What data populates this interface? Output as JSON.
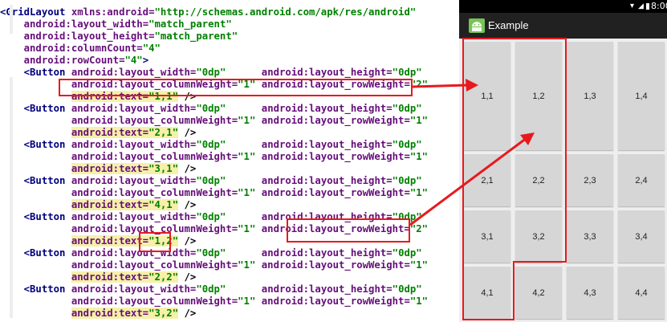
{
  "code_lines": [
    [
      {
        "c": "tag",
        "t": "<GridLayout "
      },
      {
        "c": "attr",
        "t": "xmlns:android="
      },
      {
        "c": "val",
        "t": "\"http://schemas.android.com/apk/res/android\""
      }
    ],
    [
      {
        "c": "pad",
        "t": "    "
      },
      {
        "c": "attr",
        "t": "android:layout_width="
      },
      {
        "c": "val",
        "t": "\"match_parent\""
      }
    ],
    [
      {
        "c": "pad",
        "t": "    "
      },
      {
        "c": "attr",
        "t": "android:layout_height="
      },
      {
        "c": "val",
        "t": "\"match_parent\""
      }
    ],
    [
      {
        "c": "pad",
        "t": "    "
      },
      {
        "c": "attr",
        "t": "android:columnCount="
      },
      {
        "c": "val",
        "t": "\"4\""
      }
    ],
    [
      {
        "c": "pad",
        "t": "    "
      },
      {
        "c": "attr",
        "t": "android:rowCount="
      },
      {
        "c": "val",
        "t": "\"4\""
      },
      {
        "c": "tag",
        "t": ">"
      }
    ],
    [
      {
        "c": "pad",
        "t": "    "
      },
      {
        "c": "tag",
        "t": "<Button "
      },
      {
        "c": "attr",
        "t": "android:layout_width="
      },
      {
        "c": "val",
        "t": "\"0dp\""
      },
      {
        "c": "pad",
        "t": "      "
      },
      {
        "c": "attr",
        "t": "android:layout_height="
      },
      {
        "c": "val",
        "t": "\"0dp\""
      }
    ],
    [
      {
        "c": "pad",
        "t": "            "
      },
      {
        "c": "attr",
        "t": "android:layout_columnWeight="
      },
      {
        "c": "val",
        "t": "\"1\""
      },
      {
        "c": "pad",
        "t": " "
      },
      {
        "c": "attr",
        "t": "android:layout_rowWeight="
      },
      {
        "c": "val",
        "t": "\"2\""
      }
    ],
    [
      {
        "c": "pad",
        "t": "            "
      },
      {
        "c": "attr hl",
        "t": "android:text="
      },
      {
        "c": "val hl",
        "t": "\"1,1\""
      },
      {
        "c": "txt",
        "t": " />"
      }
    ],
    [
      {
        "c": "pad",
        "t": "    "
      },
      {
        "c": "tag",
        "t": "<Button "
      },
      {
        "c": "attr",
        "t": "android:layout_width="
      },
      {
        "c": "val",
        "t": "\"0dp\""
      },
      {
        "c": "pad",
        "t": "      "
      },
      {
        "c": "attr",
        "t": "android:layout_height="
      },
      {
        "c": "val",
        "t": "\"0dp\""
      }
    ],
    [
      {
        "c": "pad",
        "t": "            "
      },
      {
        "c": "attr",
        "t": "android:layout_columnWeight="
      },
      {
        "c": "val",
        "t": "\"1\""
      },
      {
        "c": "pad",
        "t": " "
      },
      {
        "c": "attr",
        "t": "android:layout_rowWeight="
      },
      {
        "c": "val",
        "t": "\"1\""
      }
    ],
    [
      {
        "c": "pad",
        "t": "            "
      },
      {
        "c": "attr hl",
        "t": "android:text="
      },
      {
        "c": "val hl",
        "t": "\"2,1\""
      },
      {
        "c": "txt",
        "t": " />"
      }
    ],
    [
      {
        "c": "pad",
        "t": "    "
      },
      {
        "c": "tag",
        "t": "<Button "
      },
      {
        "c": "attr",
        "t": "android:layout_width="
      },
      {
        "c": "val",
        "t": "\"0dp\""
      },
      {
        "c": "pad",
        "t": "      "
      },
      {
        "c": "attr",
        "t": "android:layout_height="
      },
      {
        "c": "val",
        "t": "\"0dp\""
      }
    ],
    [
      {
        "c": "pad",
        "t": "            "
      },
      {
        "c": "attr",
        "t": "android:layout_columnWeight="
      },
      {
        "c": "val",
        "t": "\"1\""
      },
      {
        "c": "pad",
        "t": " "
      },
      {
        "c": "attr",
        "t": "android:layout_rowWeight="
      },
      {
        "c": "val",
        "t": "\"1\""
      }
    ],
    [
      {
        "c": "pad",
        "t": "            "
      },
      {
        "c": "attr hl",
        "t": "android:text="
      },
      {
        "c": "val hl",
        "t": "\"3,1\""
      },
      {
        "c": "txt",
        "t": " />"
      }
    ],
    [
      {
        "c": "pad",
        "t": "    "
      },
      {
        "c": "tag",
        "t": "<Button "
      },
      {
        "c": "attr",
        "t": "android:layout_width="
      },
      {
        "c": "val",
        "t": "\"0dp\""
      },
      {
        "c": "pad",
        "t": "      "
      },
      {
        "c": "attr",
        "t": "android:layout_height="
      },
      {
        "c": "val",
        "t": "\"0dp\""
      }
    ],
    [
      {
        "c": "pad",
        "t": "            "
      },
      {
        "c": "attr",
        "t": "android:layout_columnWeight="
      },
      {
        "c": "val",
        "t": "\"1\""
      },
      {
        "c": "pad",
        "t": " "
      },
      {
        "c": "attr",
        "t": "android:layout_rowWeight="
      },
      {
        "c": "val",
        "t": "\"1\""
      }
    ],
    [
      {
        "c": "pad",
        "t": "            "
      },
      {
        "c": "attr hl",
        "t": "android:text="
      },
      {
        "c": "val hl",
        "t": "\"4,1\""
      },
      {
        "c": "txt",
        "t": " />"
      }
    ],
    [
      {
        "c": "pad",
        "t": "    "
      },
      {
        "c": "tag",
        "t": "<Button "
      },
      {
        "c": "attr",
        "t": "android:layout_width="
      },
      {
        "c": "val",
        "t": "\"0dp\""
      },
      {
        "c": "pad",
        "t": "      "
      },
      {
        "c": "attr",
        "t": "android:layout_height="
      },
      {
        "c": "val",
        "t": "\"0dp\""
      }
    ],
    [
      {
        "c": "pad",
        "t": "            "
      },
      {
        "c": "attr",
        "t": "android:layout_columnWeight="
      },
      {
        "c": "val",
        "t": "\"1\""
      },
      {
        "c": "pad",
        "t": " "
      },
      {
        "c": "attr",
        "t": "android:layout_rowWeight="
      },
      {
        "c": "val",
        "t": "\"2\""
      }
    ],
    [
      {
        "c": "pad",
        "t": "            "
      },
      {
        "c": "attr hl",
        "t": "android:text="
      },
      {
        "c": "val hl",
        "t": "\"1,2\""
      },
      {
        "c": "txt",
        "t": " />"
      }
    ],
    [
      {
        "c": "pad",
        "t": "    "
      },
      {
        "c": "tag",
        "t": "<Button "
      },
      {
        "c": "attr",
        "t": "android:layout_width="
      },
      {
        "c": "val",
        "t": "\"0dp\""
      },
      {
        "c": "pad",
        "t": "      "
      },
      {
        "c": "attr",
        "t": "android:layout_height="
      },
      {
        "c": "val",
        "t": "\"0dp\""
      }
    ],
    [
      {
        "c": "pad",
        "t": "            "
      },
      {
        "c": "attr",
        "t": "android:layout_columnWeight="
      },
      {
        "c": "val",
        "t": "\"1\""
      },
      {
        "c": "pad",
        "t": " "
      },
      {
        "c": "attr",
        "t": "android:layout_rowWeight="
      },
      {
        "c": "val",
        "t": "\"1\""
      }
    ],
    [
      {
        "c": "pad",
        "t": "            "
      },
      {
        "c": "attr hl",
        "t": "android:text="
      },
      {
        "c": "val hl",
        "t": "\"2,2\""
      },
      {
        "c": "txt",
        "t": " />"
      }
    ],
    [
      {
        "c": "pad",
        "t": "    "
      },
      {
        "c": "tag",
        "t": "<Button "
      },
      {
        "c": "attr",
        "t": "android:layout_width="
      },
      {
        "c": "val",
        "t": "\"0dp\""
      },
      {
        "c": "pad",
        "t": "      "
      },
      {
        "c": "attr",
        "t": "android:layout_height="
      },
      {
        "c": "val",
        "t": "\"0dp\""
      }
    ],
    [
      {
        "c": "pad",
        "t": "            "
      },
      {
        "c": "attr",
        "t": "android:layout_columnWeight="
      },
      {
        "c": "val",
        "t": "\"1\""
      },
      {
        "c": "pad",
        "t": " "
      },
      {
        "c": "attr",
        "t": "android:layout_rowWeight="
      },
      {
        "c": "val",
        "t": "\"1\""
      }
    ],
    [
      {
        "c": "pad",
        "t": "            "
      },
      {
        "c": "attr hl",
        "t": "android:text="
      },
      {
        "c": "val hl",
        "t": "\"3,2\""
      },
      {
        "c": "txt",
        "t": " />"
      }
    ]
  ],
  "status_bar": {
    "time": "8:00",
    "icons": [
      "wifi-icon",
      "signal-icon",
      "battery-icon"
    ]
  },
  "app_bar": {
    "title": "Example",
    "icon": "android-robot-icon"
  },
  "grid_rows": [
    [
      "1,1",
      "1,2",
      "1,3",
      "1,4"
    ],
    [
      "2,1",
      "2,2",
      "2,3",
      "2,4"
    ],
    [
      "3,1",
      "3,2",
      "3,3",
      "3,4"
    ],
    [
      "4,1",
      "4,2",
      "4,3",
      "4,4"
    ]
  ],
  "colors": {
    "annotation": "#e8191d",
    "tag": "#000080",
    "attribute": "#660e7a",
    "value": "#008000",
    "highlight": "#f6f0a8",
    "button": "#d6d6d6",
    "app_bar": "#212121"
  }
}
